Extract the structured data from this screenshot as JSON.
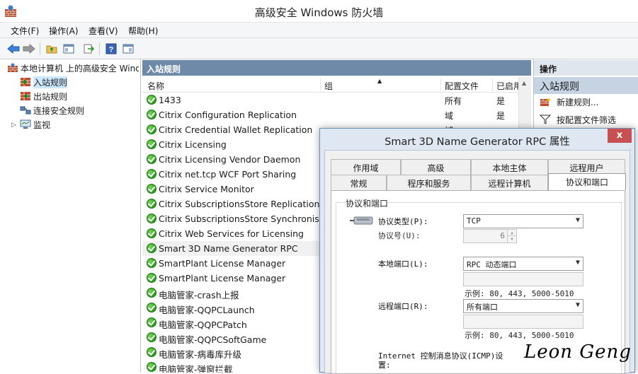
{
  "window": {
    "title": "高级安全 Windows 防火墙"
  },
  "menu": [
    "文件(F)",
    "操作(A)",
    "查看(V)",
    "帮助(H)"
  ],
  "toolbar": {
    "buttons": [
      "back-arrow-icon",
      "forward-arrow-icon",
      "up-folder-icon",
      "show-hide-tree-icon",
      "export-list-icon",
      "help-icon",
      "properties-icon"
    ]
  },
  "tree": {
    "root": "本地计算机 上的高级安全 Windows 防火墙",
    "items": [
      "入站规则",
      "出站规则",
      "连接安全规则",
      "监视"
    ]
  },
  "center": {
    "header": "入站规则",
    "columns": {
      "name": "名称",
      "group": "组",
      "profile": "配置文件",
      "enabled": "已启用"
    },
    "rows": [
      {
        "name": "1433",
        "profile": "所有",
        "enabled": "是"
      },
      {
        "name": "Citrix Configuration Replication",
        "profile": "域",
        "enabled": "是"
      },
      {
        "name": "Citrix Credential Wallet Replication",
        "profile": "域",
        "enabled": ""
      },
      {
        "name": "Citrix Licensing",
        "profile": "",
        "enabled": ""
      },
      {
        "name": "Citrix Licensing Vendor Daemon",
        "profile": "",
        "enabled": ""
      },
      {
        "name": "Citrix net.tcp WCF Port Sharing",
        "profile": "",
        "enabled": ""
      },
      {
        "name": "Citrix Service Monitor",
        "profile": "",
        "enabled": ""
      },
      {
        "name": "Citrix SubscriptionsStore Replication",
        "profile": "",
        "enabled": ""
      },
      {
        "name": "Citrix SubscriptionsStore Synchronisa...",
        "profile": "",
        "enabled": ""
      },
      {
        "name": "Citrix Web Services for Licensing",
        "profile": "",
        "enabled": ""
      },
      {
        "name": "Smart 3D Name Generator RPC",
        "profile": "",
        "enabled": ""
      },
      {
        "name": "SmartPlant License Manager",
        "profile": "",
        "enabled": ""
      },
      {
        "name": "SmartPlant License Manager",
        "profile": "",
        "enabled": ""
      },
      {
        "name": "电脑管家-crash上报",
        "profile": "",
        "enabled": ""
      },
      {
        "name": "电脑管家-QQPCLaunch",
        "profile": "",
        "enabled": ""
      },
      {
        "name": "电脑管家-QQPCPatch",
        "profile": "",
        "enabled": ""
      },
      {
        "name": "电脑管家-QQPCSoftGame",
        "profile": "",
        "enabled": ""
      },
      {
        "name": "电脑管家-病毒库升级",
        "profile": "",
        "enabled": ""
      },
      {
        "name": "电脑管家-弹窗拦截",
        "profile": "",
        "enabled": ""
      }
    ]
  },
  "actions": {
    "title": "操作",
    "section": "入站规则",
    "items": [
      "新建规则...",
      "按配置文件筛选"
    ]
  },
  "dialog": {
    "title": "Smart 3D Name Generator RPC 属性",
    "close": "x",
    "tabs_row1": [
      "作用域",
      "高级",
      "本地主体",
      "远程用户"
    ],
    "tabs_row2": [
      "常规",
      "程序和服务",
      "远程计算机",
      "协议和端口"
    ],
    "group_title": "协议和端口",
    "protocol_type_label": "协议类型(P):",
    "protocol_type_value": "TCP",
    "protocol_number_label": "协议号(U):",
    "protocol_number_value": "6",
    "local_port_label": "本地端口(L):",
    "local_port_value": "RPC 动态端口",
    "local_example": "示例: 80, 443, 5000-5010",
    "remote_port_label": "远程端口(R):",
    "remote_port_value": "所有端口",
    "remote_example": "示例: 80, 443, 5000-5010",
    "icmp_label_1": "Internet 控制消息协议(ICMP)设",
    "icmp_label_2": "置:"
  },
  "watermark": "Leon Geng"
}
